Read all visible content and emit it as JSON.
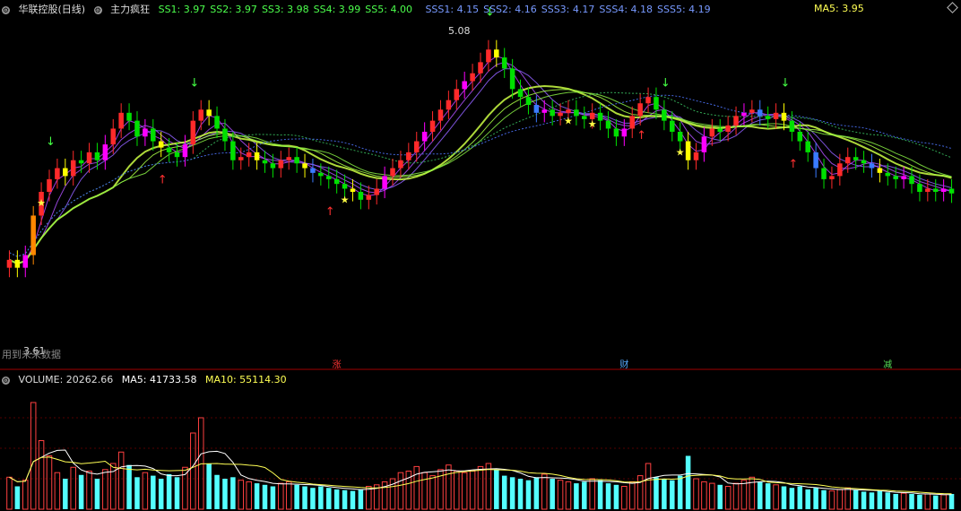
{
  "header": {
    "stock_name": "华联控股(日线)",
    "indicator_name": "主力疯狂",
    "ss": [
      {
        "label": "SS1",
        "value": "3.97"
      },
      {
        "label": "SS2",
        "value": "3.97"
      },
      {
        "label": "SS3",
        "value": "3.98"
      },
      {
        "label": "SS4",
        "value": "3.99"
      },
      {
        "label": "SS5",
        "value": "4.00"
      }
    ],
    "sss": [
      {
        "label": "SSS1",
        "value": "4.15"
      },
      {
        "label": "SSS2",
        "value": "4.16"
      },
      {
        "label": "SSS3",
        "value": "4.17"
      },
      {
        "label": "SSS4",
        "value": "4.18"
      },
      {
        "label": "SSS5",
        "value": "4.19"
      }
    ],
    "ma5_label": "MA5: 3.95"
  },
  "volume_header": {
    "title": "VOLUME: 20262.66",
    "ma5": "MA5: 41733.58",
    "ma10": "MA10: 55114.30"
  },
  "notice": "用到未来数据",
  "tags": [
    {
      "text": "涨",
      "color": "#ff3333",
      "index": 41
    },
    {
      "text": "财",
      "color": "#55aaff",
      "index": 77
    },
    {
      "text": "减",
      "color": "#55dd55",
      "index": 110
    }
  ],
  "colors": {
    "up": "#ff2a2a",
    "down": "#00e000",
    "magenta": "#ff00ff",
    "yellow": "#ffff00",
    "blue": "#3a7bff",
    "orange": "#ff8800",
    "volume_up": "#ff4040",
    "volume_down": "#54ffff",
    "vol_ma5": "#ffffff",
    "vol_ma10": "#ffff54",
    "ss_text": "#4cff4c",
    "sss_text": "#7799ff"
  },
  "chart_data": {
    "type": "candlestick",
    "price_range": [
      3.0,
      5.2
    ],
    "high_label": "5.08",
    "low_label": "3.61",
    "candle_count": 119,
    "closes": [
      3.67,
      3.62,
      3.7,
      3.95,
      4.1,
      4.18,
      4.25,
      4.2,
      4.3,
      4.28,
      4.35,
      4.3,
      4.4,
      4.5,
      4.6,
      4.55,
      4.45,
      4.5,
      4.42,
      4.38,
      4.35,
      4.32,
      4.4,
      4.55,
      4.62,
      4.58,
      4.5,
      4.42,
      4.3,
      4.32,
      4.35,
      4.3,
      4.28,
      4.25,
      4.3,
      4.32,
      4.28,
      4.25,
      4.22,
      4.2,
      4.18,
      4.15,
      4.12,
      4.1,
      4.05,
      4.08,
      4.12,
      4.2,
      4.25,
      4.3,
      4.35,
      4.42,
      4.48,
      4.55,
      4.62,
      4.68,
      4.75,
      4.8,
      4.85,
      4.92,
      5.0,
      4.95,
      4.88,
      4.75,
      4.7,
      4.65,
      4.6,
      4.62,
      4.58,
      4.6,
      4.62,
      4.58,
      4.56,
      4.6,
      4.55,
      4.5,
      4.45,
      4.5,
      4.58,
      4.66,
      4.7,
      4.62,
      4.55,
      4.48,
      4.42,
      4.3,
      4.35,
      4.45,
      4.5,
      4.48,
      4.52,
      4.58,
      4.6,
      4.62,
      4.58,
      4.56,
      4.6,
      4.55,
      4.48,
      4.42,
      4.35,
      4.25,
      4.18,
      4.2,
      4.28,
      4.32,
      4.3,
      4.28,
      4.25,
      4.22,
      4.2,
      4.18,
      4.2,
      4.15,
      4.1,
      4.12,
      4.1,
      4.12,
      4.09
    ],
    "volume": [
      42,
      30,
      38,
      140,
      90,
      70,
      48,
      40,
      55,
      45,
      50,
      40,
      52,
      60,
      75,
      58,
      42,
      48,
      44,
      40,
      46,
      42,
      55,
      100,
      120,
      60,
      45,
      40,
      42,
      38,
      36,
      34,
      32,
      30,
      34,
      36,
      32,
      30,
      28,
      30,
      28,
      26,
      25,
      24,
      26,
      30,
      32,
      36,
      40,
      48,
      50,
      56,
      48,
      44,
      52,
      58,
      50,
      48,
      50,
      56,
      60,
      52,
      44,
      42,
      40,
      38,
      42,
      46,
      40,
      38,
      36,
      34,
      36,
      40,
      38,
      34,
      32,
      30,
      36,
      44,
      60,
      42,
      40,
      38,
      44,
      70,
      40,
      36,
      34,
      32,
      30,
      34,
      38,
      42,
      36,
      34,
      32,
      30,
      28,
      30,
      26,
      28,
      25,
      24,
      26,
      28,
      25,
      23,
      22,
      24,
      22,
      20,
      21,
      20,
      19,
      20,
      18,
      19,
      20
    ],
    "volume_range": [
      0,
      160
    ]
  }
}
